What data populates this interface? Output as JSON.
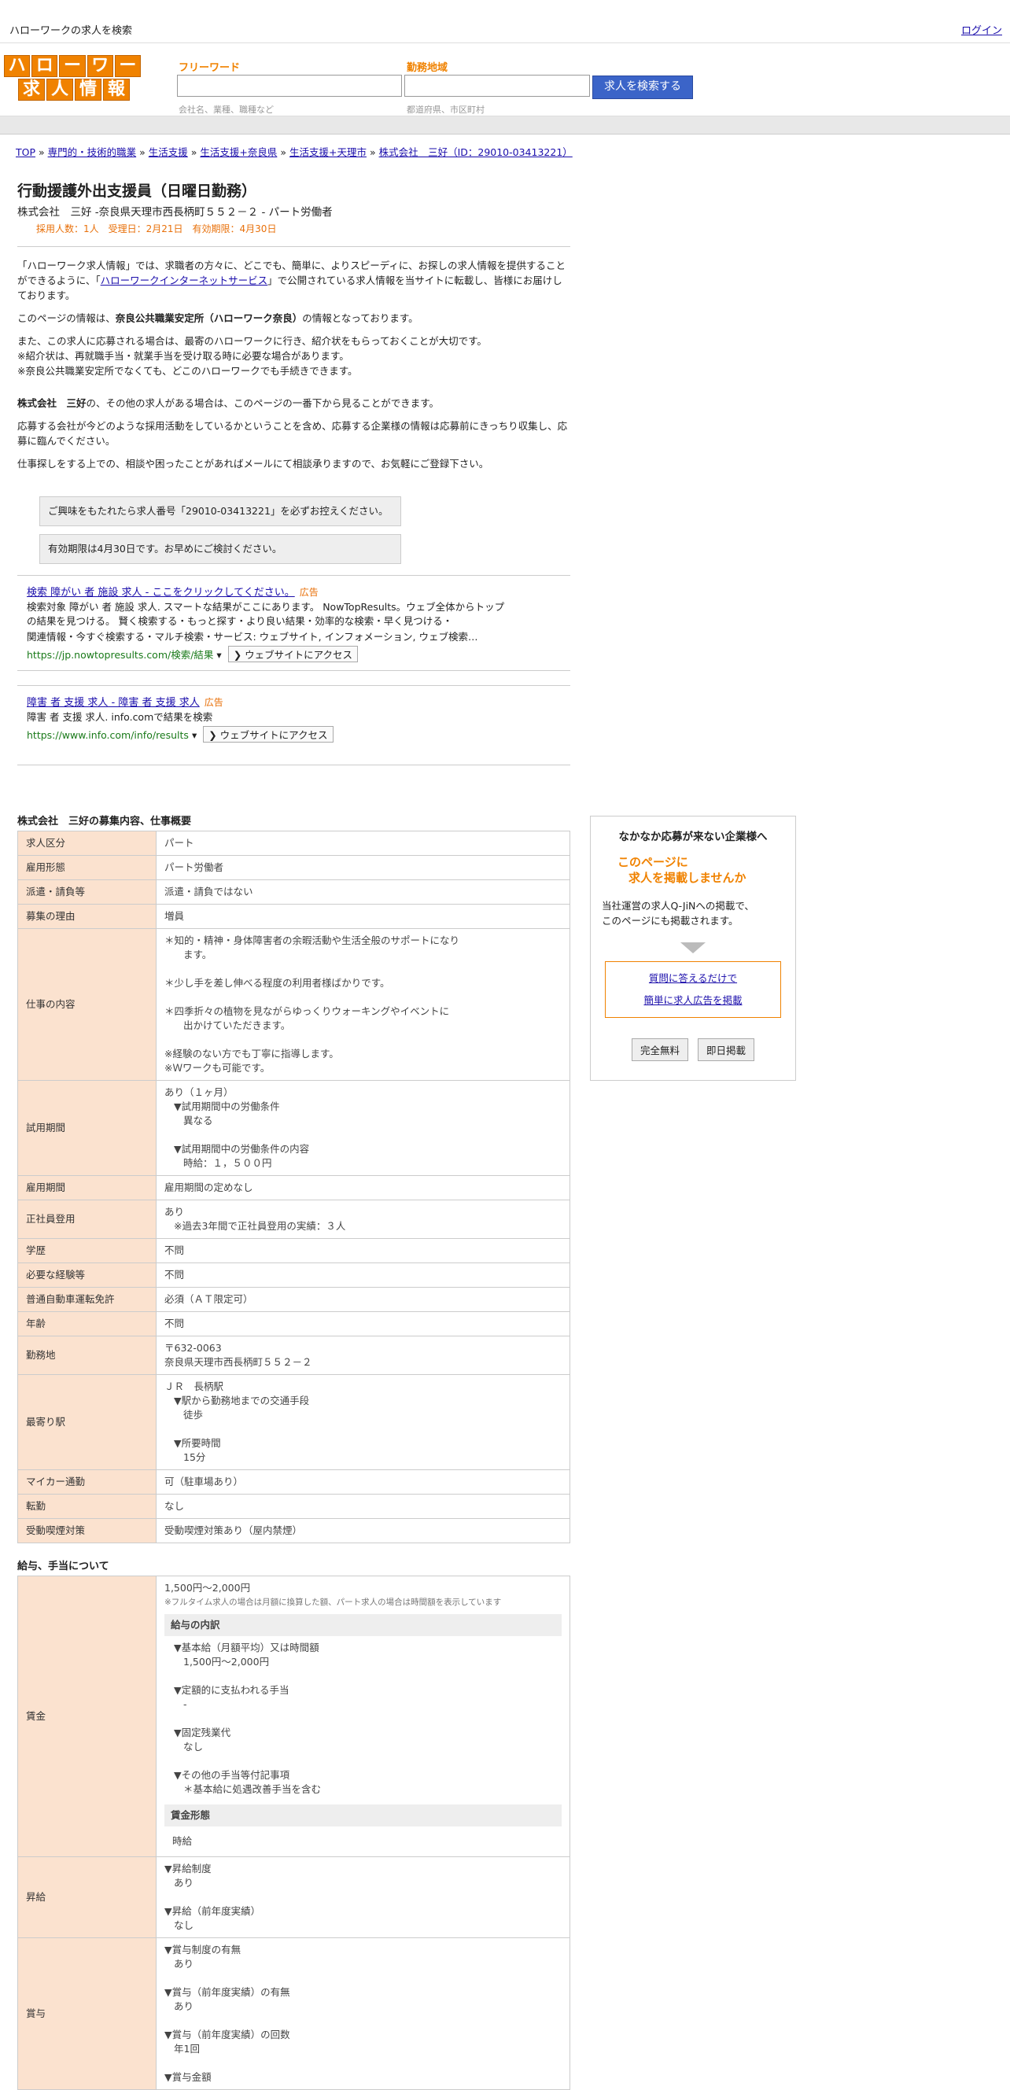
{
  "topbar": {
    "title": "ハローワークの求人を検索",
    "login": "ログイン"
  },
  "logo": {
    "row1": [
      "ハ",
      "ロ",
      "ー",
      "ワ",
      "ー",
      "ク"
    ],
    "row2": [
      "求",
      "人",
      "情",
      "報"
    ]
  },
  "search": {
    "freeword_label": "フリーワード",
    "freeword_hint": "会社名、業種、職種など",
    "area_label": "勤務地域",
    "area_hint": "都道府県、市区町村",
    "button": "求人を検索する"
  },
  "breadcrumb": [
    "TOP",
    "専門的・技術的職業",
    "生活支援",
    "生活支援+奈良県",
    "生活支援+天理市",
    "株式会社　三好（ID：29010-03413221）"
  ],
  "job": {
    "title": "行動援護外出支援員（日曜日勤務）",
    "subtitle": "株式会社　三好 -奈良県天理市西長柄町５５２－２ - パート労働者",
    "meta": "採用人数：1人　受理日：2月21日　有効期限：4月30日"
  },
  "intro": {
    "p1_a": "「ハローワーク求人情報」では、求職者の方々に、どこでも、簡単に、よりスピーディに、お探しの求人情報を提供することができるように、「",
    "p1_link": "ハローワークインターネットサービス",
    "p1_b": "」で公開されている求人情報を当サイトに転載し、皆様にお届けしております。",
    "p2_a": "このページの情報は、",
    "p2_bold": "奈良公共職業安定所（ハローワーク奈良）",
    "p2_b": "の情報となっております。",
    "p3_l1": "また、この求人に応募される場合は、最寄のハローワークに行き、紹介状をもらっておくことが大切です。",
    "p3_l2": "※紹介状は、再就職手当・就業手当を受け取る時に必要な場合があります。",
    "p3_l3": "※奈良公共職業安定所でなくても、どこのハローワークでも手続きできます。",
    "p4_bold": "株式会社　三好",
    "p4_b": "の、その他の求人がある場合は、このページの一番下から見ることができます。",
    "p5": "応募する会社が今どのような採用活動をしているかということを含め、応募する企業様の情報は応募前にきっちり収集し、応募に臨んでください。",
    "p6": "仕事探しをする上での、相談や困ったことがあればメールにて相談承りますので、お気軽にご登録下さい。"
  },
  "notices": [
    "ご興味をもたれたら求人番号「29010-03413221」を必ずお控えください。",
    "有効期限は4月30日です。お早めにご検討ください。"
  ],
  "ads": [
    {
      "title": "検索 障がい 者 施設 求人 - ここをクリックしてください。",
      "tag": "広告",
      "desc1": "検索対象 障がい 者 施設 求人. スマートな結果がここにあります。 NowTopResults。ウェブ全体からトップの結果を見つける。 賢く検索する・もっと探す・より良い結果・効率的な検索・早く見つける・",
      "desc2": "関連情報・今すぐ検索する・マルチ検索・サービス: ウェブサイト, インフォメーション, ウェブ検索…",
      "url": "https://jp.nowtopresults.com/検索/結果",
      "visit": "❯ ウェブサイトにアクセス"
    },
    {
      "title": "障害 者 支援 求人 - 障害 者 支援 求人",
      "tag": "広告",
      "desc1": "障害 者 支援 求人. info.comで結果を検索",
      "desc2": "",
      "url": "https://www.info.com/info/results",
      "visit": "❯ ウェブサイトにアクセス"
    }
  ],
  "overview": {
    "title": "株式会社　三好の募集内容、仕事概要",
    "rows": {
      "r1_h": "求人区分",
      "r1_v": "パート",
      "r2_h": "雇用形態",
      "r2_v": "パート労働者",
      "r3_h": "派遣・請負等",
      "r3_v": "派遣・請負ではない",
      "r4_h": "募集の理由",
      "r4_v": "増員",
      "r5_h": "仕事の内容",
      "r5_v1": "＊知的・精神・身体障害者の余暇活動や生活全般のサポートになり",
      "r5_v1b": "ます。",
      "r5_v2": "＊少し手を差し伸べる程度の利用者様ばかりです。",
      "r5_v3": "＊四季折々の植物を見ながらゆっくりウォーキングやイベントに",
      "r5_v3b": "出かけていただきます。",
      "r5_v4": "※経験のない方でも丁寧に指導します。",
      "r5_v5": "※Ｗワークも可能です。",
      "r6_h": "試用期間",
      "r6_v1": "あり（１ヶ月）",
      "r6_v2": "▼試用期間中の労働条件",
      "r6_v3": "異なる",
      "r6_v4": "▼試用期間中の労働条件の内容",
      "r6_v5": "時給：１，５００円",
      "r7_h": "雇用期間",
      "r7_v": "雇用期間の定めなし",
      "r8_h": "正社員登用",
      "r8_v1": "あり",
      "r8_v2": "※過去3年間で正社員登用の実績：３人",
      "r9_h": "学歴",
      "r9_v": "不問",
      "r10_h": "必要な経験等",
      "r10_v": "不問",
      "r11_h": "普通自動車運転免許",
      "r11_v": "必須（ＡＴ限定可）",
      "r12_h": "年齢",
      "r12_v": "不問",
      "r13_h": "勤務地",
      "r13_v1": "〒632-0063",
      "r13_v2": "奈良県天理市西長柄町５５２－２",
      "r14_h": "最寄り駅",
      "r14_v1": "ＪＲ　長柄駅",
      "r14_v2": "▼駅から勤務地までの交通手段",
      "r14_v3": "徒歩",
      "r14_v4": "▼所要時間",
      "r14_v5": "15分",
      "r15_h": "マイカー通勤",
      "r15_v": "可（駐車場あり）",
      "r16_h": "転勤",
      "r16_v": "なし",
      "r17_h": "受動喫煙対策",
      "r17_v": "受動喫煙対策あり（屋内禁煙）"
    }
  },
  "salary": {
    "title": "給与、手当について",
    "wage_h": "賃金",
    "wage_v1": "1,500円〜2,000円",
    "wage_note": "※フルタイム求人の場合は月額に換算した額、パート求人の場合は時間額を表示しています",
    "breakdown_head": "給与の内訳",
    "b1": "▼基本給（月額平均）又は時間額",
    "b1v": "1,500円〜2,000円",
    "b2": "▼定額的に支払われる手当",
    "b2v": "-",
    "b3": "▼固定残業代",
    "b3v": "なし",
    "b4": "▼その他の手当等付記事項",
    "b4v": "＊基本給に処遇改善手当を含む",
    "form_head": "賃金形態",
    "form_v": "時給",
    "raise_h": "昇給",
    "raise1": "▼昇給制度",
    "raise1v": "あり",
    "raise2": "▼昇給（前年度実績）",
    "raise2v": "なし",
    "bonus_h": "賞与",
    "bonus1": "▼賞与制度の有無",
    "bonus1v": "あり",
    "bonus2": "▼賞与（前年度実績）の有無",
    "bonus2v": "あり",
    "bonus3": "▼賞与（前年度実績）の回数",
    "bonus3v": "年1回",
    "bonus4": "▼賞与金額"
  },
  "sidebar": {
    "title": "なかなか応募が来ない企業様へ",
    "orange1": "このページに",
    "orange2": "求人を掲載しませんか",
    "text1": "当社運営の求人Q-JiNへの掲載で、",
    "text2": "このページにも掲載されます。",
    "link1": "質問に答えるだけで",
    "link2": "簡単に求人広告を掲載",
    "btn1": "完全無料",
    "btn2": "即日掲載"
  }
}
